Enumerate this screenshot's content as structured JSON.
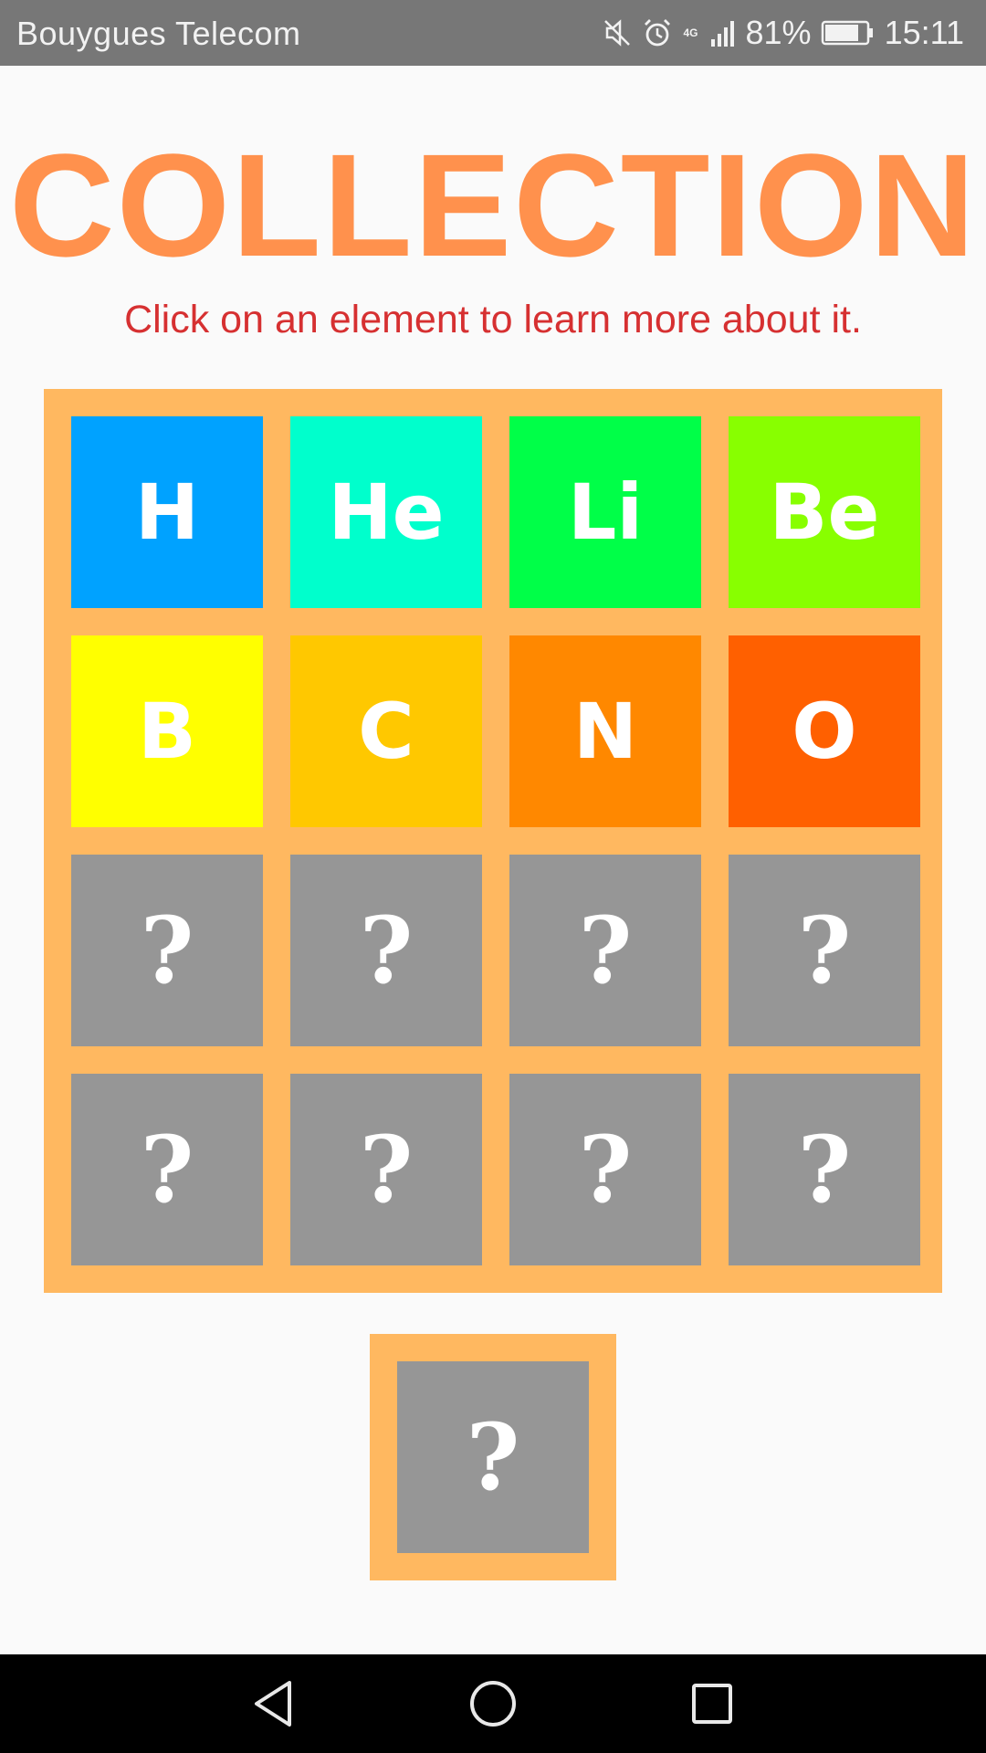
{
  "status_bar": {
    "carrier": "Bouygues Telecom",
    "network": "4G",
    "battery_percent": "81%",
    "battery_level": 0.81,
    "time": "15:11",
    "icons": [
      "mute-icon",
      "alarm-icon",
      "signal-icon",
      "battery-icon"
    ]
  },
  "header": {
    "title": "COLLECTION",
    "subtitle": "Click on an element to learn more about it."
  },
  "colors": {
    "title": "#ff914d",
    "subtitle": "#d63031",
    "frame": "#ffb860",
    "locked": "#969696"
  },
  "tiles": [
    {
      "label": "H",
      "color": "#00a2ff"
    },
    {
      "label": "He",
      "color": "#00ffcc"
    },
    {
      "label": "Li",
      "color": "#00ff48"
    },
    {
      "label": "Be",
      "color": "#88ff00"
    },
    {
      "label": "B",
      "color": "#ffff00"
    },
    {
      "label": "C",
      "color": "#ffc800"
    },
    {
      "label": "N",
      "color": "#ff8800"
    },
    {
      "label": "O",
      "color": "#ff6000"
    },
    {
      "label": "?",
      "color": "#969696"
    },
    {
      "label": "?",
      "color": "#969696"
    },
    {
      "label": "?",
      "color": "#969696"
    },
    {
      "label": "?",
      "color": "#969696"
    },
    {
      "label": "?",
      "color": "#969696"
    },
    {
      "label": "?",
      "color": "#969696"
    },
    {
      "label": "?",
      "color": "#969696"
    },
    {
      "label": "?",
      "color": "#969696"
    }
  ],
  "bonus_tile": {
    "label": "?",
    "color": "#969696"
  },
  "nav": {
    "buttons": [
      "back-icon",
      "home-icon",
      "recents-icon"
    ]
  }
}
